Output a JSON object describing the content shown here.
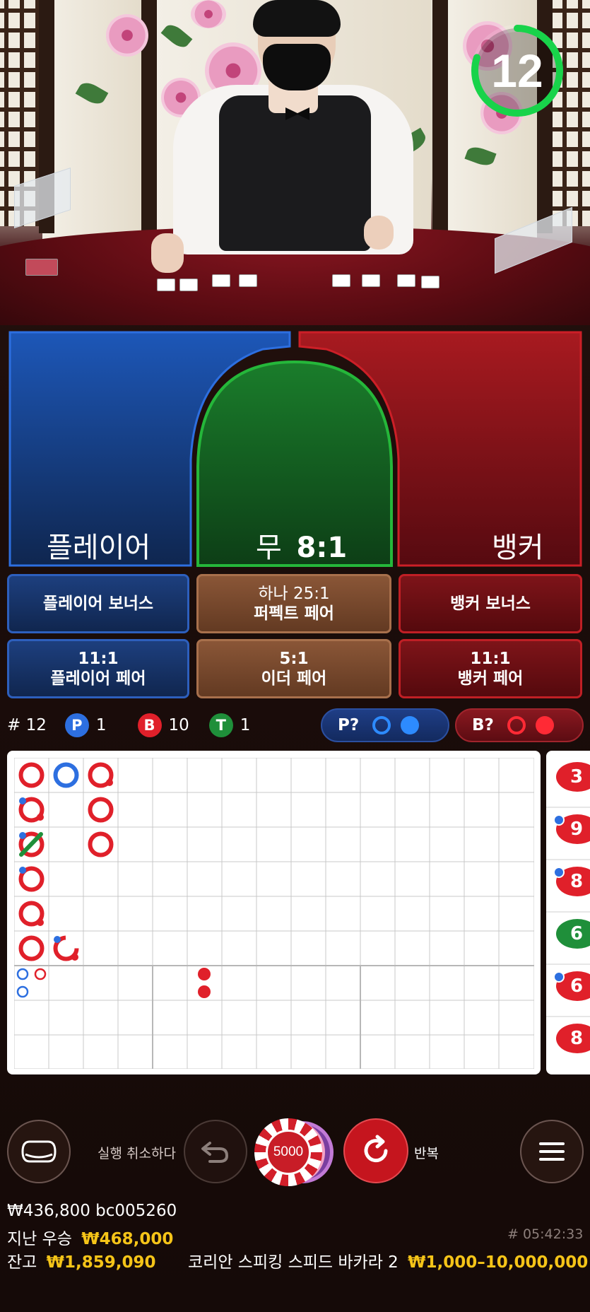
{
  "timer": {
    "seconds": "12",
    "fraction_remaining": 0.8
  },
  "bets": {
    "player_label": "플레이어",
    "tie_label": "무",
    "tie_odds": "8:1",
    "banker_label": "뱅커",
    "player_bonus": "플레이어 보너스",
    "perfect_pair_line1": "하나 25:1",
    "perfect_pair_line2": "퍼펙트 페어",
    "banker_bonus": "뱅커 보너스",
    "player_pair_odds": "11:1",
    "player_pair_label": "플레이어 페어",
    "either_pair_odds": "5:1",
    "either_pair_label": "이더 페어",
    "banker_pair_odds": "11:1",
    "banker_pair_label": "뱅커 페어"
  },
  "stats": {
    "round": "# 12",
    "player_letter": "P",
    "player_count": "1",
    "banker_letter": "B",
    "banker_count": "10",
    "tie_letter": "T",
    "tie_count": "1",
    "player_predict": "P?",
    "banker_predict": "B?"
  },
  "side_road": [
    "3",
    "9",
    "8",
    "6",
    "6",
    "8"
  ],
  "controls": {
    "undo_label": "실행 취소하다",
    "chip_value": "5000",
    "repeat_label": "반복"
  },
  "footer": {
    "bet_total": "₩436,800 bc005260",
    "last_win_label": "지난 우승",
    "last_win_value": "₩468,000",
    "round_time": "# 05:42:33",
    "balance_label": "잔고",
    "balance_value": "₩1,859,090",
    "table_name": "코리안 스피킹 스피드 바카라 2",
    "limits": "₩1,000–10,000,000"
  },
  "colors": {
    "player": "#2d6fe0",
    "banker": "#e0202a",
    "tie": "#1f8f3a",
    "gold": "#f5c418",
    "timer": "#18d34a"
  }
}
